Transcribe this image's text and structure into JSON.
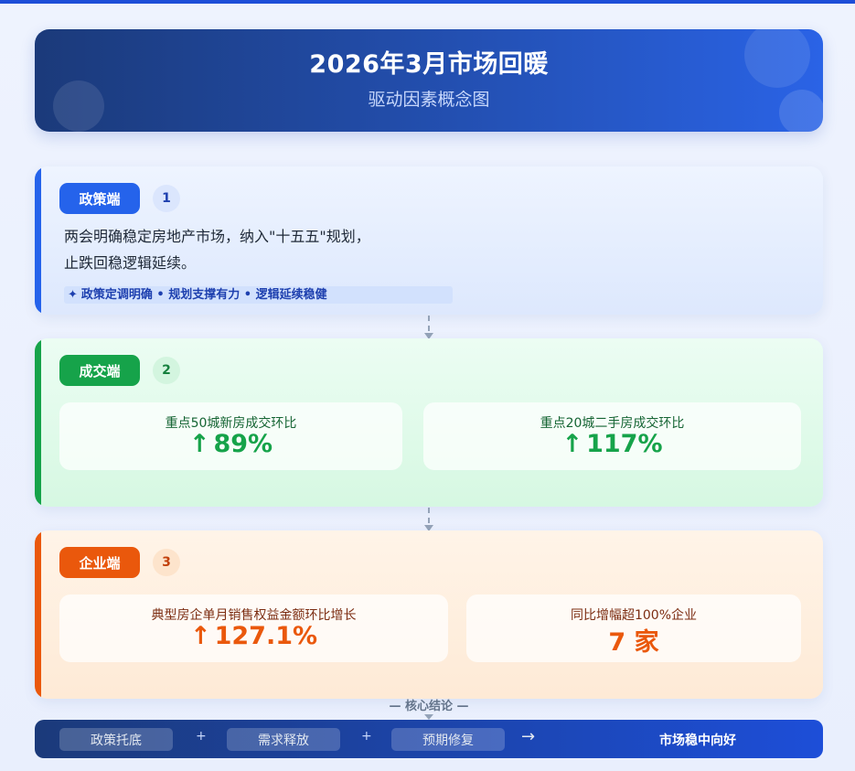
{
  "header": {
    "title": "2026年3月市场回暖",
    "subtitle": "驱动因素概念图"
  },
  "policy": {
    "tag": "政策端",
    "index": "1",
    "lines": [
      "两会明确稳定房地产市场，纳入\"十五五\"规划，",
      "止跌回稳逻辑延续。"
    ],
    "note": "政策定调明确 • 规划支撑有力 • 逻辑延续稳健"
  },
  "deal": {
    "tag": "成交端",
    "index": "2",
    "stats": [
      {
        "label": "重点50城新房成交环比",
        "value": "89%"
      },
      {
        "label": "重点20城二手房成交环比",
        "value": "117%"
      }
    ]
  },
  "corp": {
    "tag": "企业端",
    "index": "3",
    "stats": [
      {
        "label": "典型房企单月销售权益金额环比增长",
        "value": "127.1%"
      },
      {
        "label": "同比增幅超100%企业",
        "value": "7 家"
      }
    ]
  },
  "core": {
    "label": "— 核心结论 —",
    "chips": [
      "政策托底",
      "需求释放",
      "预期修复"
    ],
    "plus": "+",
    "arrow": "→",
    "result": "市场稳中向好"
  },
  "icons": {
    "up_arrow": "↑",
    "sparkle": "✦"
  },
  "colors": {
    "policy": "#2563eb",
    "deal": "#16a34a",
    "corp": "#ea580c",
    "header": "#1d4ed8"
  }
}
